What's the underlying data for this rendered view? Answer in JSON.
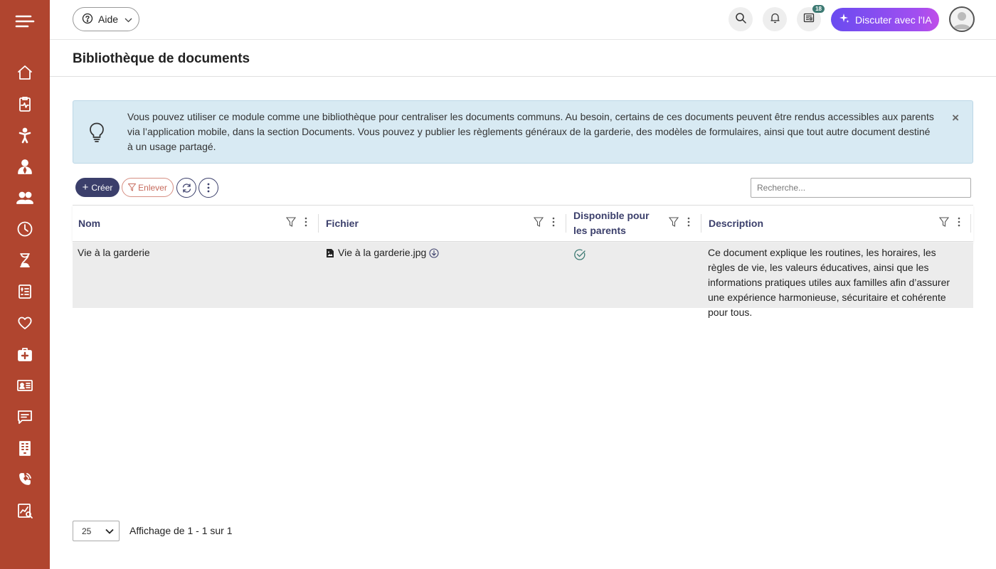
{
  "header": {
    "help_label": "Aide",
    "notifications_badge": "18",
    "ai_button_label": "Discuter avec l'IA"
  },
  "page": {
    "title": "Bibliothèque de documents"
  },
  "info": {
    "text": "Vous pouvez utiliser ce module comme une bibliothèque pour centraliser les documents communs. Au besoin, certains de ces documents peuvent être rendus accessibles aux parents via l’application mobile, dans la section Documents. Vous pouvez y publier les règlements généraux de la garderie, des modèles de formulaires, ainsi que tout autre document destiné à un usage partagé.",
    "close_glyph": "×"
  },
  "toolbar": {
    "create_label": "Créer",
    "clear_label": "Enlever",
    "search_placeholder": "Recherche..."
  },
  "grid": {
    "columns": [
      "Nom",
      "Fichier",
      "Disponible pour les parents",
      "Description"
    ],
    "rows": [
      {
        "name": "Vie à la garderie",
        "file": "Vie à la garderie.jpg",
        "available": true,
        "description": "Ce document explique les routines, les horaires, les règles de vie, les valeurs éducatives, ainsi que les informations pratiques utiles aux familles afin d’assurer une expérience harmonieuse, sécuritaire et cohérente pour tous."
      }
    ]
  },
  "pager": {
    "page_size": "25",
    "info": "Affichage de 1 - 1 sur 1"
  },
  "colors": {
    "sidebar": "#b0452f",
    "accent": "#3b3f6b",
    "info_bg": "#d8eaf3",
    "ai_gradient_start": "#6a4cf0",
    "ai_gradient_end": "#c04ee8"
  },
  "sidebar": {
    "icons": [
      "menu-icon",
      "home-icon",
      "clipboard-health-icon",
      "child-icon",
      "staff-icon",
      "group-icon",
      "clock-icon",
      "hourglass-icon",
      "invoice-icon",
      "heart-icon",
      "first-aid-icon",
      "id-card-icon",
      "message-icon",
      "building-icon",
      "phone-icon",
      "report-icon"
    ]
  }
}
